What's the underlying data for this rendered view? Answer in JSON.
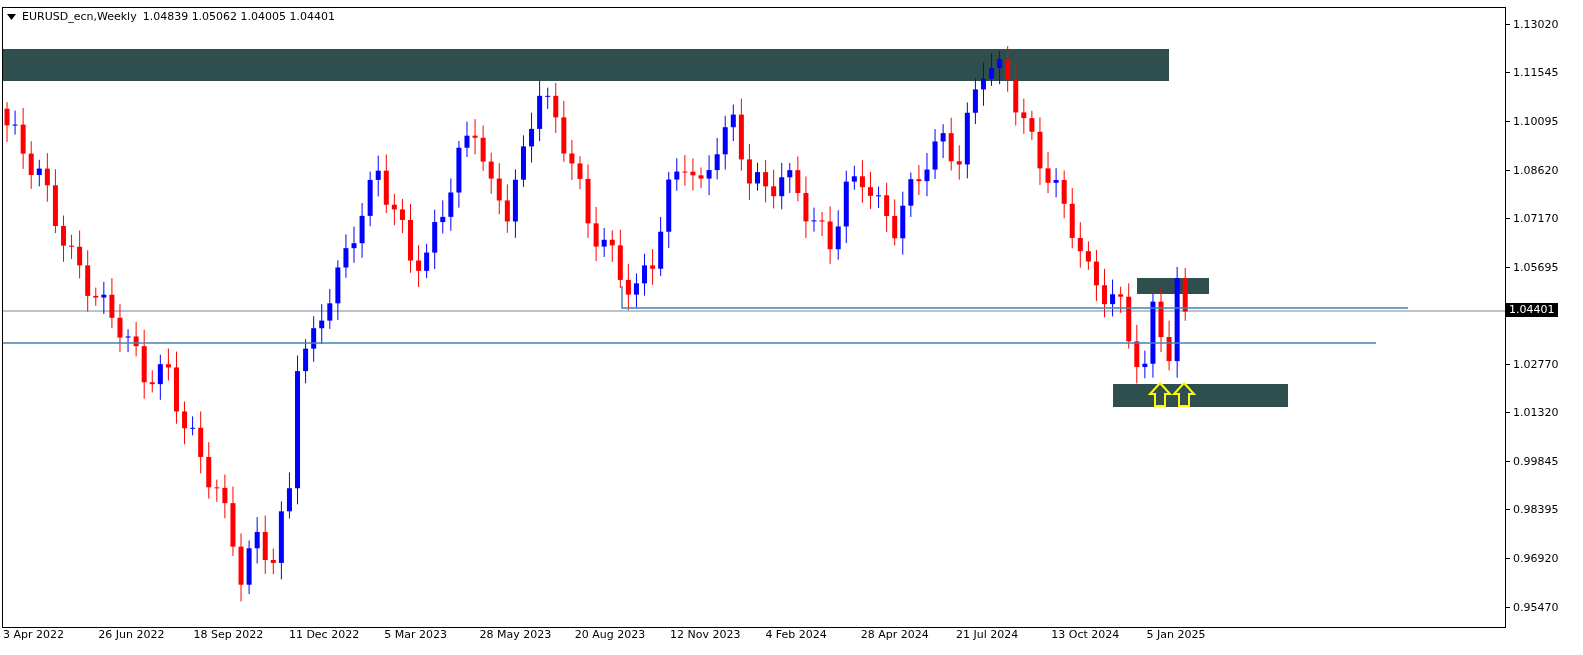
{
  "header": {
    "symbol": "EURUSD_ecn,Weekly",
    "quotes": [
      "1.04839",
      "1.05062",
      "1.04005",
      "1.04401"
    ]
  },
  "price_axis": {
    "ticks": [
      "1.13020",
      "1.11545",
      "1.10095",
      "1.08620",
      "1.07170",
      "1.05695",
      "1.02770",
      "1.01320",
      "0.99845",
      "0.98395",
      "0.96920",
      "0.95470"
    ],
    "current_price": "1.04401"
  },
  "time_axis": {
    "ticks": [
      "3 Apr 2022",
      "26 Jun 2022",
      "18 Sep 2022",
      "11 Dec 2022",
      "5 Mar 2023",
      "28 May 2023",
      "20 Aug 2023",
      "12 Nov 2023",
      "4 Feb 2024",
      "28 Apr 2024",
      "21 Jul 2024",
      "13 Oct 2024",
      "5 Jan 2025"
    ]
  }
}
